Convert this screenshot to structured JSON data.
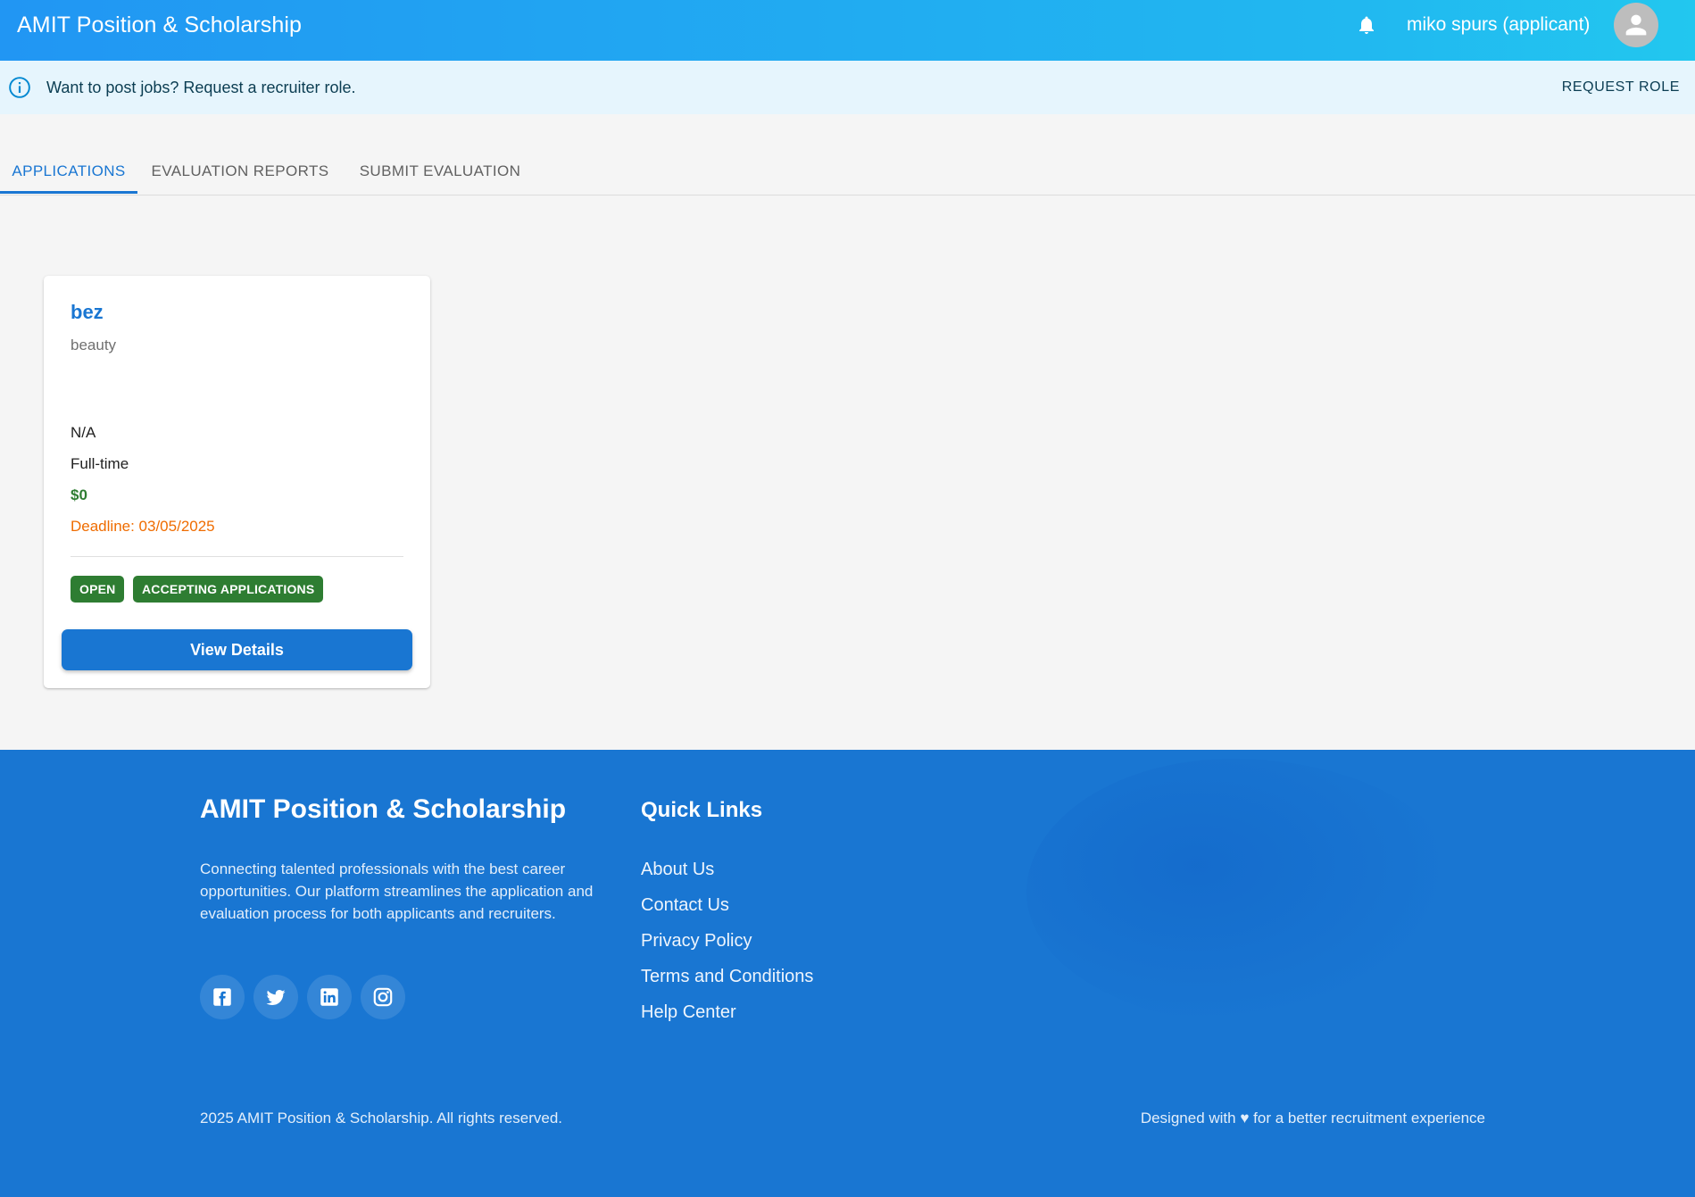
{
  "appbar": {
    "title": "AMIT Position & Scholarship",
    "user_label": "miko spurs (applicant)",
    "icons": {
      "notifications": "bell-icon",
      "account": "account-circle-icon"
    }
  },
  "banner": {
    "message": "Want to post jobs? Request a recruiter role.",
    "action_label": "REQUEST ROLE",
    "icon": "info-icon"
  },
  "tabs": [
    {
      "label": "APPLICATIONS",
      "active": true
    },
    {
      "label": "EVALUATION REPORTS",
      "active": false
    },
    {
      "label": "SUBMIT EVALUATION",
      "active": false
    }
  ],
  "job_card": {
    "title": "bez",
    "category": "beauty",
    "location": "N/A",
    "type": "Full-time",
    "salary": "$0",
    "deadline": "Deadline: 03/05/2025",
    "chips": [
      "OPEN",
      "ACCEPTING APPLICATIONS"
    ],
    "button_label": "View Details"
  },
  "footer": {
    "brand": "AMIT Position & Scholarship",
    "about": "Connecting talented professionals with the best career opportunities. Our platform streamlines the application and evaluation process for both applicants and recruiters.",
    "social_icons": [
      "facebook-icon",
      "twitter-icon",
      "linkedin-icon",
      "instagram-icon"
    ],
    "quick_links_title": "Quick Links",
    "quick_links": [
      "About Us",
      "Contact Us",
      "Privacy Policy",
      "Terms and Conditions",
      "Help Center"
    ],
    "copyright": "2025 AMIT Position & Scholarship. All rights reserved.",
    "designed": "Designed with ♥ for a better recruitment experience"
  },
  "colors": {
    "primary": "#1976d2",
    "appbar_gradient_start": "#2196f3",
    "appbar_gradient_end": "#22c7ef",
    "banner_bg": "#e6f5fd",
    "success": "#2e7d32",
    "warning": "#ef6c00"
  }
}
